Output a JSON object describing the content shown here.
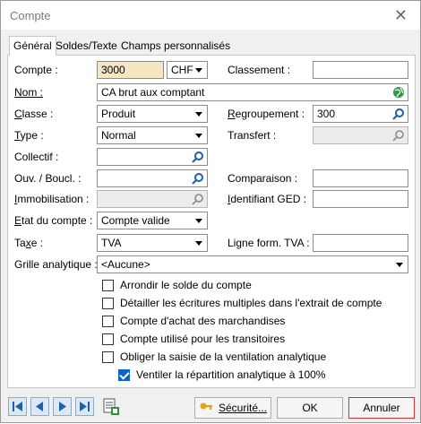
{
  "window": {
    "title": "Compte"
  },
  "tabs": [
    {
      "label": "Général"
    },
    {
      "label": "Soldes/Texte"
    },
    {
      "label": "Champs personnalisés"
    }
  ],
  "form": {
    "compte": {
      "label": "Compte :",
      "value": "3000",
      "currency": "CHF"
    },
    "classement": {
      "label": "Classement :",
      "value": ""
    },
    "nom": {
      "label": "Nom :",
      "value": "CA brut aux comptant"
    },
    "classe": {
      "label": "Classe :",
      "value": "Produit"
    },
    "regroupement": {
      "label": "Regroupement :",
      "value": "300"
    },
    "type": {
      "label": "Type :",
      "value": "Normal"
    },
    "transfert": {
      "label": "Transfert :",
      "value": ""
    },
    "collectif": {
      "label": "Collectif :",
      "value": ""
    },
    "ouv_bouc": {
      "label": "Ouv. / Boucl. :",
      "value": ""
    },
    "comparaison": {
      "label": "Comparaison :",
      "value": ""
    },
    "immobilisation": {
      "label": "Immobilisation :",
      "value": ""
    },
    "identifiant_ged": {
      "label": "Identifiant GED :",
      "value": ""
    },
    "etat": {
      "label": "Etat du compte :",
      "value": "Compte valide"
    },
    "taxe": {
      "label": "Taxe :",
      "value": "TVA"
    },
    "ligne_form_tva": {
      "label": "Ligne form. TVA :",
      "value": ""
    },
    "grille": {
      "label": "Grille analytique :",
      "value": "<Aucune>"
    }
  },
  "options": [
    {
      "label": "Arrondir le solde du compte",
      "checked": false
    },
    {
      "label": "Détailler les écritures multiples dans l'extrait de compte",
      "checked": false
    },
    {
      "label": "Compte d'achat des marchandises",
      "checked": false
    },
    {
      "label": "Compte utilisé pour les transitoires",
      "checked": false
    },
    {
      "label": "Obliger la saisie de la ventilation analytique",
      "checked": false
    },
    {
      "label": "Ventiler la répartition analytique à 100%",
      "checked": true
    }
  ],
  "buttons": {
    "securite": "Sécurité...",
    "ok": "OK",
    "annuler": "Annuler"
  },
  "colors": {
    "highlight": "#f7e6c2",
    "nav": "#1d5fae",
    "cancel_border": "#d23232",
    "check": "#0b64c9"
  },
  "icons": [
    "close-icon",
    "search-icon",
    "globe-icon",
    "first-record-icon",
    "previous-record-icon",
    "next-record-icon",
    "last-record-icon",
    "document-icon",
    "key-icon"
  ]
}
